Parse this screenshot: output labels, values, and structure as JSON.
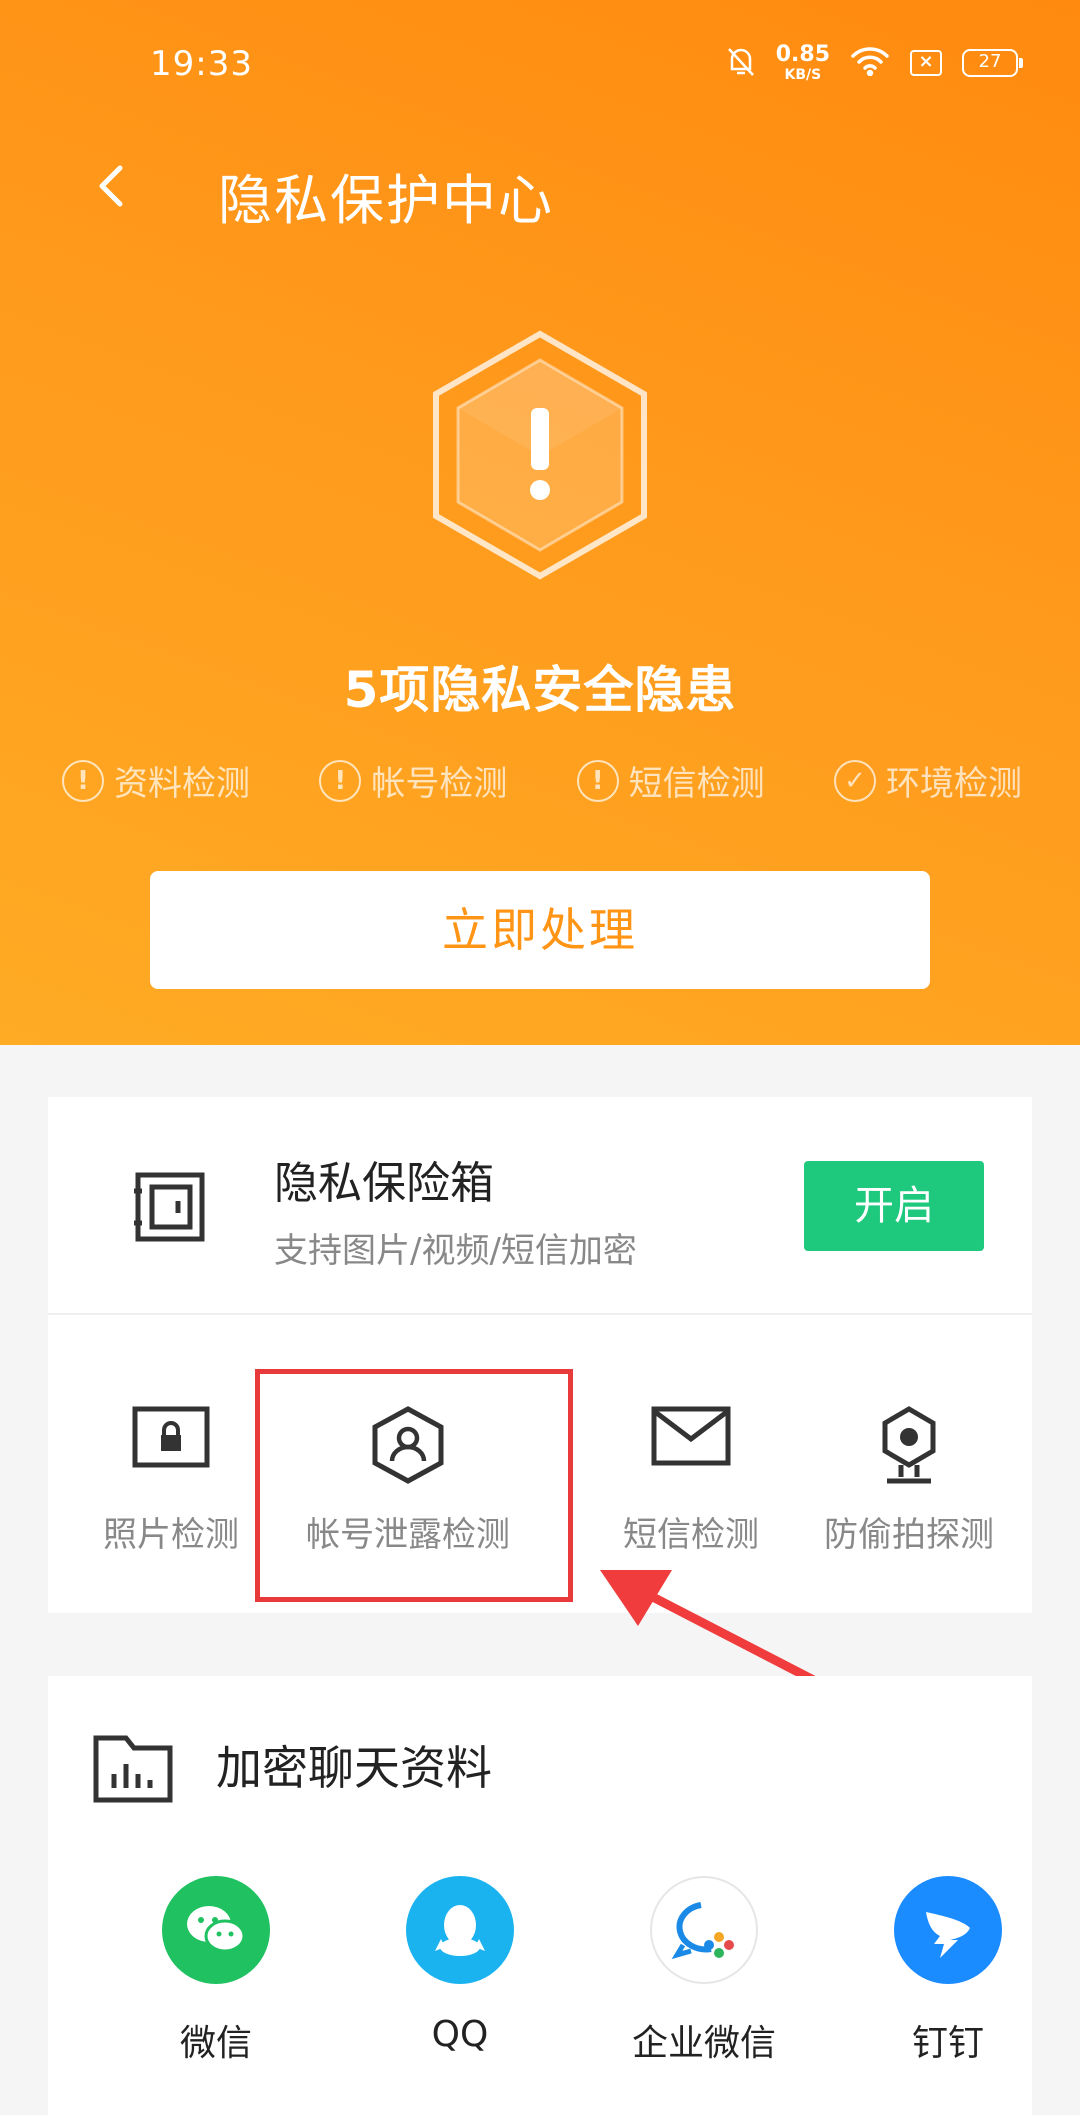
{
  "status_bar": {
    "time": "19:33",
    "net_speed_value": "0.85",
    "net_speed_unit": "KB/S",
    "battery": "27"
  },
  "header": {
    "title": "隐私保护中心",
    "back_icon": "chevron-left-icon"
  },
  "summary": {
    "shield_icon": "hexagon-warning-icon",
    "hazard_text": "5项隐私安全隐患",
    "checks": [
      {
        "label": "资料检测",
        "state": "warning"
      },
      {
        "label": "帐号检测",
        "state": "warning"
      },
      {
        "label": "短信检测",
        "state": "warning"
      },
      {
        "label": "环境检测",
        "state": "ok"
      }
    ],
    "action_button": "立即处理"
  },
  "vault": {
    "title": "隐私保险箱",
    "subtitle": "支持图片/视频/短信加密",
    "button": "开启",
    "icon": "safe-icon"
  },
  "features": [
    {
      "label": "照片检测",
      "icon": "photo-lock-icon"
    },
    {
      "label": "帐号泄露检测",
      "icon": "account-shield-icon"
    },
    {
      "label": "短信检测",
      "icon": "envelope-icon"
    },
    {
      "label": "防偷拍探测",
      "icon": "camera-detect-icon"
    }
  ],
  "encrypted_chat": {
    "title": "加密聊天资料",
    "icon": "folder-chart-icon",
    "apps": [
      {
        "name": "微信",
        "icon": "wechat-icon",
        "color": "#1fc160"
      },
      {
        "name": "QQ",
        "icon": "qq-icon",
        "color": "#1ab3f0"
      },
      {
        "name": "企业微信",
        "icon": "wecom-icon",
        "color": "#ffffff"
      },
      {
        "name": "钉钉",
        "icon": "dingtalk-icon",
        "color": "#1a8cff"
      }
    ]
  },
  "colors": {
    "accent_orange": "#ff9415",
    "open_green": "#1ec87c",
    "highlight_red": "#e83a3a"
  }
}
